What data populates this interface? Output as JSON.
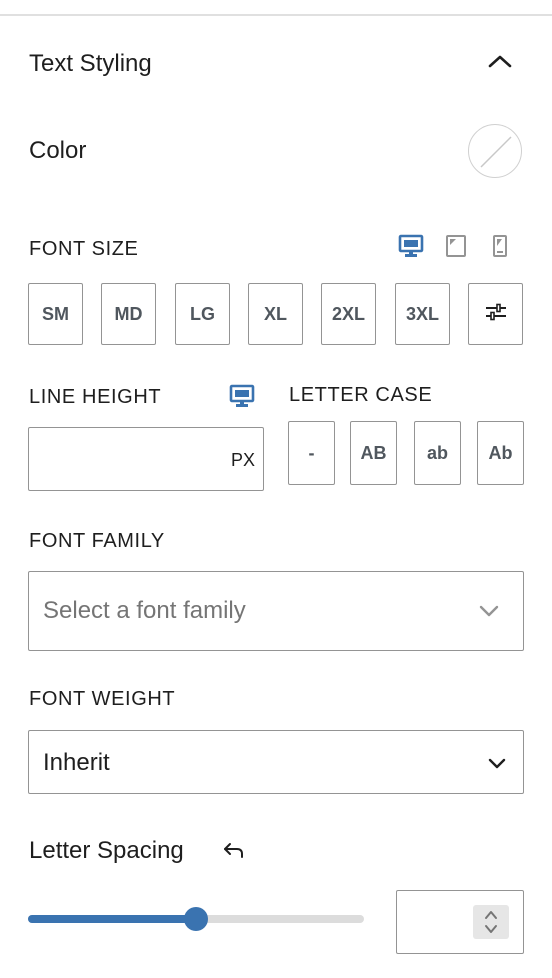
{
  "panel": {
    "title": "Text Styling"
  },
  "color": {
    "label": "Color"
  },
  "font_size": {
    "label": "FONT SIZE",
    "devices": [
      "desktop-icon",
      "tablet-icon",
      "mobile-icon"
    ],
    "active_device": "desktop",
    "presets": [
      "SM",
      "MD",
      "LG",
      "XL",
      "2XL",
      "3XL"
    ],
    "custom_icon": "sliders-icon"
  },
  "line_height": {
    "label": "LINE HEIGHT",
    "value": "",
    "unit": "PX"
  },
  "letter_case": {
    "label": "LETTER CASE",
    "options": [
      "-",
      "AB",
      "ab",
      "Ab"
    ]
  },
  "font_family": {
    "label": "FONT FAMILY",
    "placeholder": "Select a font family"
  },
  "font_weight": {
    "label": "FONT WEIGHT",
    "value": "Inherit"
  },
  "letter_spacing": {
    "label": "Letter Spacing",
    "value": "",
    "slider_fraction": 0.5
  },
  "colors": {
    "accent": "#3a73b0",
    "border": "#949494",
    "muted_icon": "#949494"
  }
}
